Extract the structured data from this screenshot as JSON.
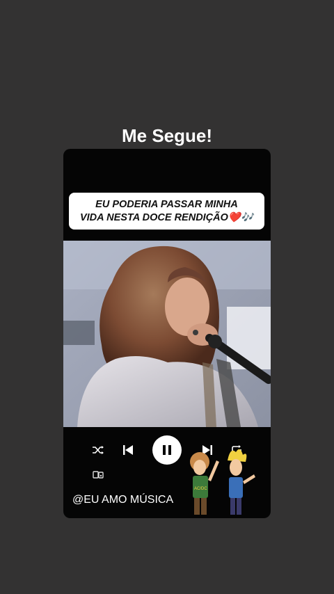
{
  "header": {
    "title": "Me Segue!"
  },
  "lyric": {
    "line1": "EU PODERIA PASSAR MINHA",
    "line2": "VIDA NESTA DOCE RENDIÇÃO❤️🎶"
  },
  "player": {
    "state": "playing",
    "controls": [
      "shuffle-icon",
      "previous-icon",
      "pause-icon",
      "next-icon",
      "repeat-icon"
    ],
    "device_icon": "connect-device-icon"
  },
  "footer": {
    "handle": "@EU AMO MÚSICA"
  },
  "cartoon_shirt_text": "AC/DC",
  "colors": {
    "background": "#333232",
    "card": "#050505",
    "lyric_box": "#ffffff",
    "text": "#ffffff"
  }
}
